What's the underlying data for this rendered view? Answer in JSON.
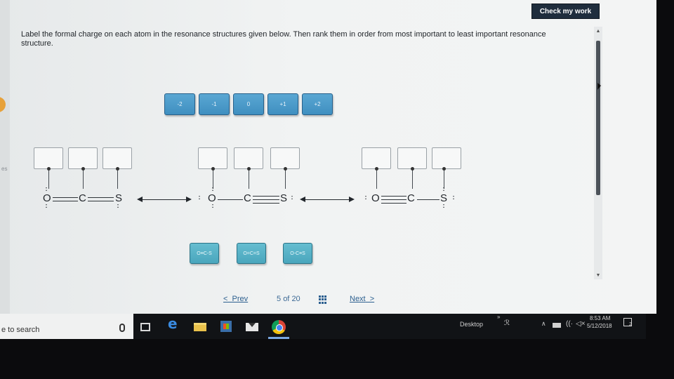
{
  "header": {
    "check_label": "Check my work"
  },
  "instructions": "Label the formal charge on each atom in the resonance structures given below. Then rank them in order from most important to least important resonance structure.",
  "side_label": "es",
  "charge_tiles": [
    "-2",
    "-1",
    "0",
    "+1",
    "+2"
  ],
  "structures": [
    {
      "left_atom": "O",
      "mid_atom": "C",
      "right_atom": "S",
      "o_bond": "double",
      "s_bond": "double"
    },
    {
      "left_atom": "O",
      "mid_atom": "C",
      "right_atom": "S",
      "o_bond": "single",
      "s_bond": "triple"
    },
    {
      "left_atom": "O",
      "mid_atom": "C",
      "right_atom": "S",
      "o_bond": "triple",
      "s_bond": "single"
    }
  ],
  "ranking_tiles": [
    "O≡C-S",
    "O=C=S",
    "O-C≡S"
  ],
  "pager": {
    "prev": "Prev",
    "current": "5",
    "of": "of",
    "total": "20",
    "next": "Next"
  },
  "taskbar": {
    "search_placeholder": "e to search",
    "desktop_label": "Desktop",
    "chevron": "»",
    "time": "8:53 AM",
    "date": "5/12/2018",
    "notifications": "2"
  },
  "icons": {
    "edge": "e",
    "people": "ℛ",
    "tray_up": "∧",
    "wifi": "((·",
    "volume": "◁×",
    "scroll_up": "▲",
    "scroll_down": "▼"
  },
  "colors": {
    "accent": "#3f8fc0",
    "rank_tile": "#4aa6bd",
    "link": "#2c5f8f",
    "check_button": "#1f2d3d"
  }
}
